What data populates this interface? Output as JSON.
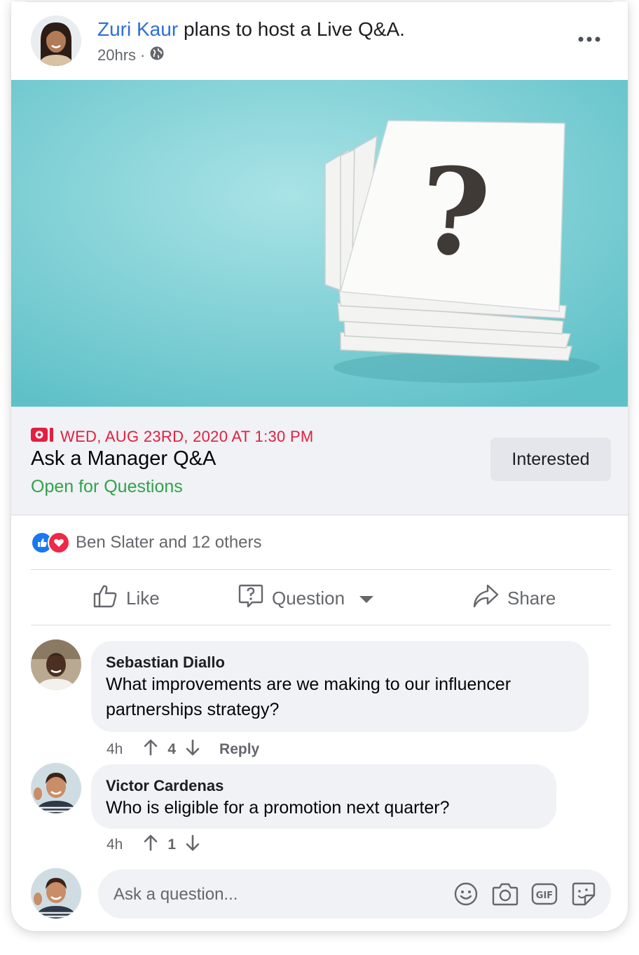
{
  "post": {
    "author": "Zuri Kaur",
    "action_text": "plans to host a Live Q&A.",
    "time": "20hrs",
    "separator": "·",
    "privacy_icon": "globe-icon",
    "more_icon": "more-options-icon"
  },
  "hero": {
    "description": "stack of white cards with a question mark on a teal background",
    "symbol": "?"
  },
  "event": {
    "date": "WED, AUG 23RD, 2020 AT 1:30 PM",
    "title": "Ask a Manager Q&A",
    "status": "Open for Questions",
    "interest_label": "Interested"
  },
  "reactions": {
    "summary": "Ben Slater and 12 others",
    "types": [
      "like",
      "love"
    ]
  },
  "actions": {
    "like": "Like",
    "question": "Question",
    "share": "Share"
  },
  "comments": [
    {
      "author": "Sebastian Diallo",
      "text": "What improvements are we making to our influencer partnerships strategy?",
      "time": "4h",
      "votes": "4",
      "reply": "Reply"
    },
    {
      "author": "Victor Cardenas",
      "text": "Who is eligible for a promotion next quarter?",
      "time": "4h",
      "votes": "1"
    }
  ],
  "composer": {
    "placeholder": "Ask a question...",
    "icons": [
      "emoji-icon",
      "camera-icon",
      "gif-icon",
      "sticker-icon"
    ]
  },
  "colors": {
    "link_blue": "#2d6fd6",
    "live_red": "#e41e3f",
    "status_green": "#31a24c",
    "secondary_text": "#65676b",
    "bubble_bg": "#f0f2f5"
  }
}
